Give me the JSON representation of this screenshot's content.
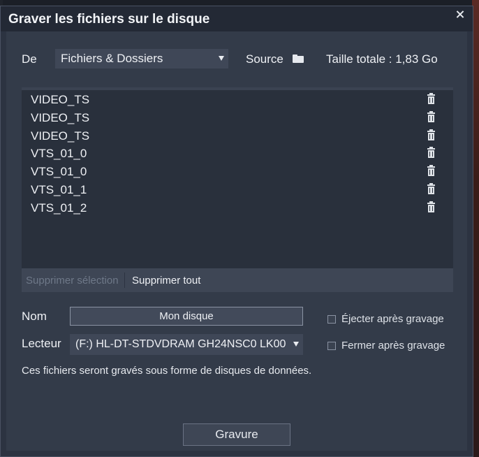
{
  "window": {
    "title": "Graver les fichiers sur le disque"
  },
  "source_row": {
    "from_label": "De",
    "from_value": "Fichiers & Dossiers",
    "source_label": "Source",
    "total_size": "Taille totale : 1,83 Go"
  },
  "files": [
    {
      "name": "VIDEO_TS"
    },
    {
      "name": "VIDEO_TS"
    },
    {
      "name": "VIDEO_TS"
    },
    {
      "name": "VTS_01_0"
    },
    {
      "name": "VTS_01_0"
    },
    {
      "name": "VTS_01_1"
    },
    {
      "name": "VTS_01_2"
    }
  ],
  "list_toolbar": {
    "delete_selection": "Supprimer sélection",
    "delete_all": "Supprimer tout"
  },
  "form": {
    "name_label": "Nom",
    "name_value": "Mon disque",
    "drive_label": "Lecteur",
    "drive_value": "(F:) HL-DT-STDVDRAM GH24NSC0 LK00",
    "eject_label": "Éjecter après gravage",
    "eject_checked": false,
    "close_label": "Fermer après gravage",
    "close_checked": false
  },
  "info_text": "Ces fichiers seront gravés sous forme de disques de données.",
  "burn_button": "Gravure",
  "icons": {
    "close": "close-icon",
    "folder": "folder-icon",
    "trash": "trash-icon",
    "dropdown": "chevron-down-icon"
  },
  "colors": {
    "dialog_bg": "#2c3341",
    "panel_bg": "#333b49",
    "list_bg": "#29303c",
    "text": "#eef0f4"
  }
}
